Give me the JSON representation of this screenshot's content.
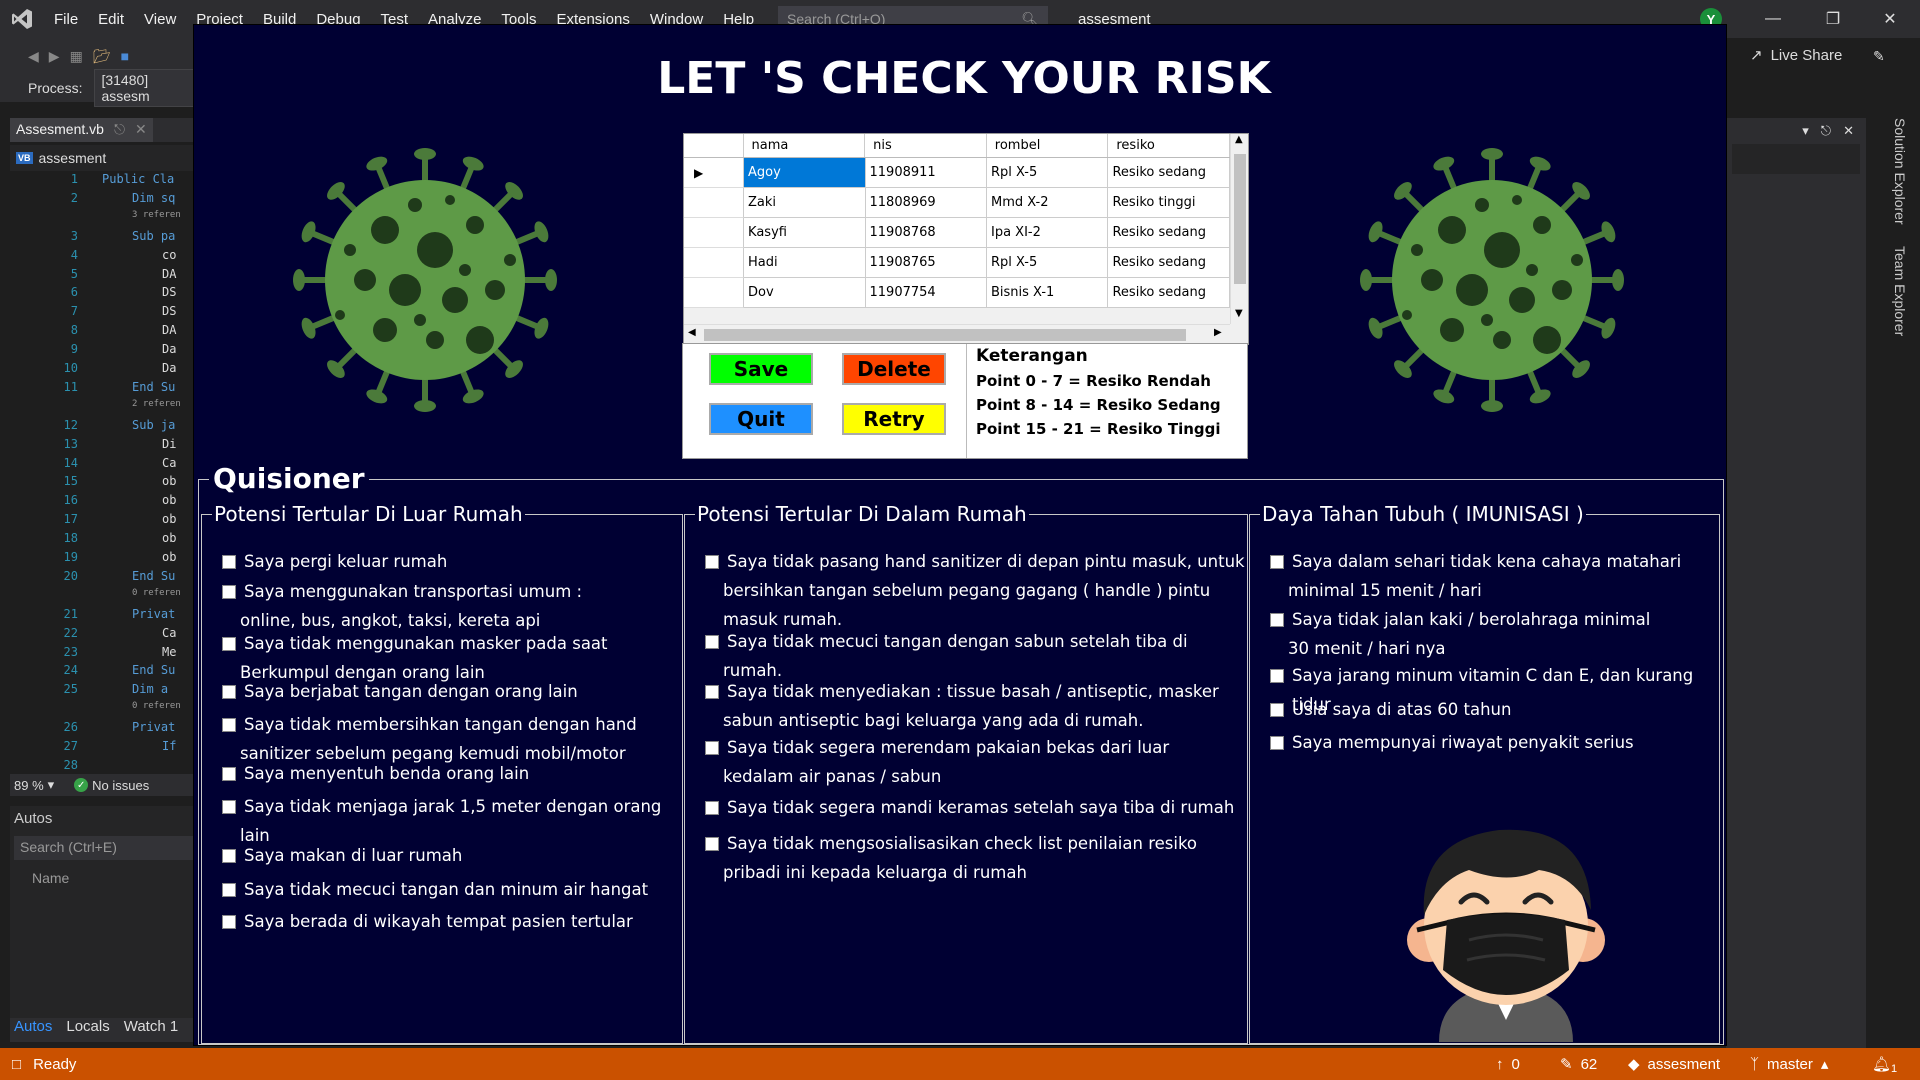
{
  "vs": {
    "menu": [
      "File",
      "Edit",
      "View",
      "Project",
      "Build",
      "Debug",
      "Test",
      "Analyze",
      "Tools",
      "Extensions",
      "Window",
      "Help"
    ],
    "search_placeholder": "Search (Ctrl+Q)",
    "title": "assesment",
    "avatar_initial": "Y",
    "process_label": "Process:",
    "process_value": "[31480] assesm",
    "live_share": "Live Share",
    "tab_name": "Assesment.vb",
    "nav_scope": "assesment",
    "vb_badge": "VB",
    "zoom": "89 %",
    "no_issues": "No issues",
    "autos_title": "Autos",
    "autos_search": "Search (Ctrl+E)",
    "autos_name_col": "Name",
    "autos_tabs": [
      "Autos",
      "Locals",
      "Watch 1"
    ],
    "side_tabs": [
      "Solution Explorer",
      "Team Explorer"
    ],
    "code_lines": [
      {
        "n": "1",
        "t": "Public Cla",
        "kw": true
      },
      {
        "n": "2",
        "t": "Dim sq",
        "kw": true,
        "indent": 1
      },
      {
        "n": "",
        "t": "3 referen",
        "refs": true,
        "indent": 1
      },
      {
        "n": "3",
        "t": "Sub pa",
        "kw": true,
        "indent": 1
      },
      {
        "n": "4",
        "t": "co",
        "indent": 2
      },
      {
        "n": "5",
        "t": "DA",
        "indent": 2
      },
      {
        "n": "6",
        "t": "DS",
        "indent": 2
      },
      {
        "n": "7",
        "t": "DS",
        "indent": 2
      },
      {
        "n": "8",
        "t": "DA",
        "indent": 2
      },
      {
        "n": "9",
        "t": "Da",
        "indent": 2
      },
      {
        "n": "10",
        "t": "Da",
        "indent": 2
      },
      {
        "n": "11",
        "t": "End Su",
        "kw": true,
        "indent": 1
      },
      {
        "n": "",
        "t": "2 referen",
        "refs": true,
        "indent": 1
      },
      {
        "n": "12",
        "t": "Sub ja",
        "kw": true,
        "indent": 1
      },
      {
        "n": "13",
        "t": "Di",
        "indent": 2
      },
      {
        "n": "14",
        "t": "Ca",
        "indent": 2
      },
      {
        "n": "15",
        "t": "ob",
        "indent": 2
      },
      {
        "n": "16",
        "t": "ob",
        "indent": 2
      },
      {
        "n": "17",
        "t": "ob",
        "indent": 2
      },
      {
        "n": "18",
        "t": "ob",
        "indent": 2
      },
      {
        "n": "19",
        "t": "ob",
        "indent": 2
      },
      {
        "n": "20",
        "t": "End Su",
        "kw": true,
        "indent": 1
      },
      {
        "n": "",
        "t": "0 referen",
        "refs": true,
        "indent": 1
      },
      {
        "n": "21",
        "t": "Privat",
        "kw": true,
        "indent": 1
      },
      {
        "n": "22",
        "t": "Ca",
        "indent": 2
      },
      {
        "n": "23",
        "t": "Me",
        "indent": 2
      },
      {
        "n": "24",
        "t": "End Su",
        "kw": true,
        "indent": 1
      },
      {
        "n": "25",
        "t": "Dim a",
        "kw": true,
        "indent": 1
      },
      {
        "n": "",
        "t": "0 referen",
        "refs": true,
        "indent": 1
      },
      {
        "n": "26",
        "t": "Privat",
        "kw": true,
        "indent": 1
      },
      {
        "n": "27",
        "t": "If",
        "kw": true,
        "indent": 2
      },
      {
        "n": "28",
        "t": "",
        "indent": 2
      }
    ],
    "status": {
      "ready": "Ready",
      "up_count": "0",
      "pencil_count": "62",
      "repo": "assesment",
      "branch": "master",
      "notif": "1"
    }
  },
  "form": {
    "title": "LET 'S CHECK YOUR RISK",
    "grid": {
      "columns": [
        "nama",
        "nis",
        "rombel",
        "resiko"
      ],
      "rows": [
        [
          "Agoy",
          "11908911",
          "Rpl X-5",
          "Resiko sedang"
        ],
        [
          "Zaki",
          "11808969",
          "Mmd X-2",
          "Resiko tinggi"
        ],
        [
          "Kasyfi",
          "11908768",
          "Ipa XI-2",
          "Resiko sedang"
        ],
        [
          "Hadi",
          "11908765",
          "Rpl X-5",
          "Resiko sedang"
        ],
        [
          "Dov",
          "11907754",
          "Bisnis X-1",
          "Resiko sedang"
        ]
      ],
      "current_row_marker": "▶"
    },
    "buttons": {
      "save": "Save",
      "delete": "Delete",
      "quit": "Quit",
      "retry": "Retry"
    },
    "button_colors": {
      "save": "#00ff00",
      "delete": "#ff4500",
      "quit": "#1e90ff",
      "retry": "#ffff00"
    },
    "keterangan": {
      "title": "Keterangan",
      "lines": [
        "Point 0 - 7 = Resiko Rendah",
        "Point 8 - 14 = Resiko Sedang",
        "Point 15 - 21 = Resiko Tinggi"
      ]
    },
    "quisioner": {
      "title": "Quisioner",
      "groups": [
        {
          "title": "Potensi Tertular Di Luar Rumah",
          "items": [
            [
              "Saya pergi keluar rumah"
            ],
            [
              "Saya menggunakan transportasi umum :",
              "online, bus, angkot, taksi, kereta api"
            ],
            [
              "Saya tidak menggunakan masker pada saat",
              "Berkumpul dengan orang lain"
            ],
            [
              "Saya berjabat tangan dengan orang lain"
            ],
            [
              "Saya tidak membersihkan tangan dengan hand",
              "sanitizer sebelum pegang kemudi mobil/motor"
            ],
            [
              "Saya menyentuh benda orang lain"
            ],
            [
              "Saya tidak menjaga jarak 1,5 meter dengan orang",
              "lain"
            ],
            [
              "Saya makan di luar rumah"
            ],
            [
              "Saya tidak mecuci tangan dan minum air hangat"
            ],
            [
              "Saya berada di wikayah tempat pasien tertular"
            ]
          ]
        },
        {
          "title": "Potensi Tertular Di Dalam Rumah",
          "items": [
            [
              "Saya tidak pasang hand sanitizer di depan pintu masuk, untuk",
              "bersihkan tangan sebelum pegang gagang ( handle ) pintu",
              "masuk rumah."
            ],
            [
              "Saya tidak mecuci tangan dengan sabun setelah tiba di",
              "rumah."
            ],
            [
              "Saya tidak menyediakan : tissue basah / antiseptic, masker",
              "sabun antiseptic bagi keluarga yang ada di rumah."
            ],
            [
              "Saya tidak segera merendam pakaian bekas dari luar",
              "kedalam air panas / sabun"
            ],
            [
              "Saya tidak segera mandi keramas setelah saya tiba di rumah"
            ],
            [
              "Saya tidak mengsosialisasikan check list penilaian resiko",
              "pribadi ini kepada keluarga di rumah"
            ]
          ]
        },
        {
          "title": "Daya Tahan Tubuh ( IMUNISASI )",
          "items": [
            [
              "Saya dalam sehari tidak kena cahaya matahari",
              "minimal 15 menit / hari"
            ],
            [
              "Saya tidak jalan kaki / berolahraga minimal",
              "30 menit / hari nya"
            ],
            [
              "Saya jarang minum vitamin C dan E, dan kurang tidur"
            ],
            [
              "Usia saya di atas 60 tahun"
            ],
            [
              "Saya mempunyai riwayat penyakit serius"
            ]
          ]
        }
      ]
    }
  }
}
